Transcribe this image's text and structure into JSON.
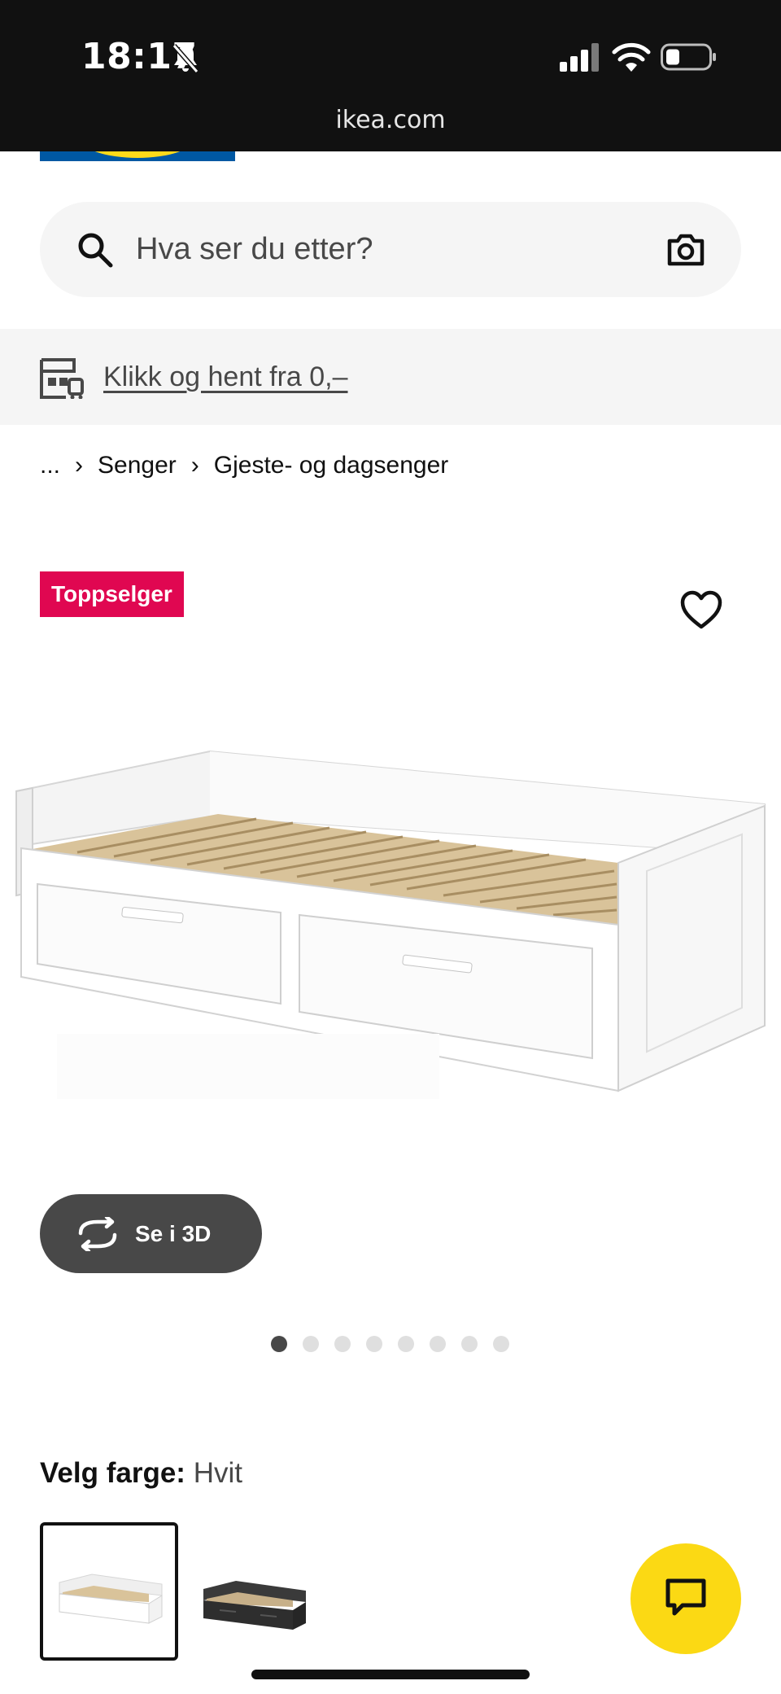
{
  "status_bar": {
    "time": "18:17",
    "url": "ikea.com",
    "icons": [
      "bell-slash-icon",
      "signal-icon",
      "wifi-icon",
      "battery-icon"
    ]
  },
  "search": {
    "placeholder": "Hva ser du etter?",
    "icons": [
      "search-icon",
      "camera-icon"
    ]
  },
  "banner": {
    "link_text": "Klikk og hent fra 0,–",
    "icon": "store-icon"
  },
  "breadcrumb": {
    "items": [
      "...",
      "Senger",
      "Gjeste- og dagsenger"
    ],
    "separator": "›"
  },
  "product": {
    "badge": "Toppselger",
    "view_3d_label": "Se i 3D",
    "image_count": 8,
    "active_image": 1
  },
  "color_selection": {
    "label": "Velg farge:",
    "selected": "Hvit",
    "options": [
      "Hvit",
      "Svart"
    ]
  },
  "colors": {
    "badge": "#e00751",
    "chat_button": "#fbd914",
    "button_dark": "#484848",
    "ikea_blue": "#0058a3",
    "ikea_yellow": "#ffda1a"
  }
}
